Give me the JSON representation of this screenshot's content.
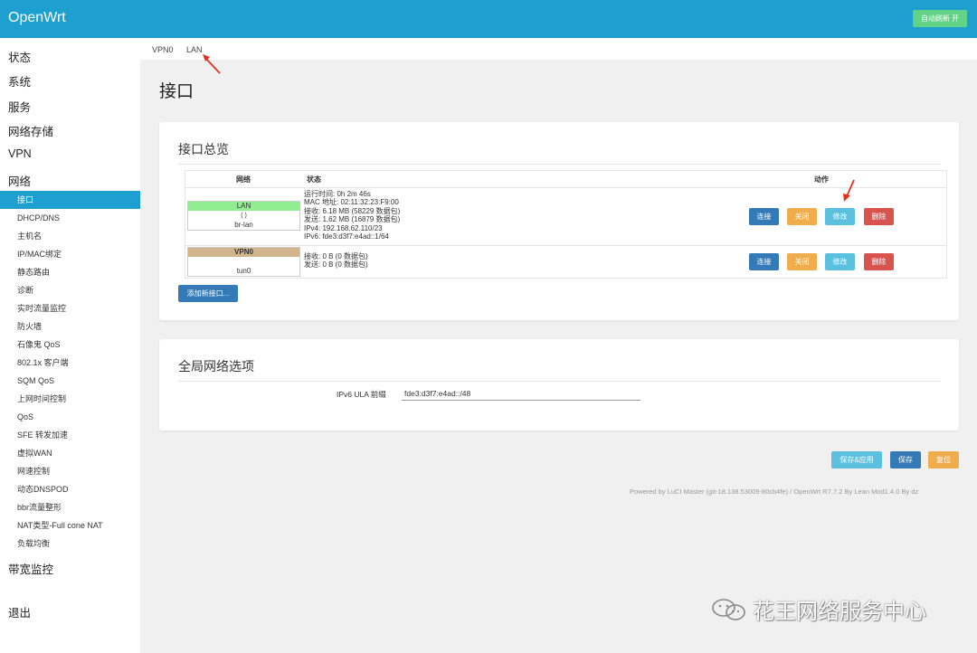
{
  "header": {
    "brand": "OpenWrt",
    "autorefresh": "自动刷新 开"
  },
  "sidebar": {
    "top": [
      "状态",
      "系统",
      "服务",
      "网络存储",
      "VPN",
      "网络"
    ],
    "network_items": [
      "接口",
      "DHCP/DNS",
      "主机名",
      "IP/MAC绑定",
      "静态路由",
      "诊断",
      "实时流量监控",
      "防火墙",
      "石像鬼 QoS",
      "802.1x 客户端",
      "SQM QoS",
      "上网时间控制",
      "QoS",
      "SFE 转发加速",
      "虚拟WAN",
      "网速控制",
      "动态DNSPOD",
      "bbr流量整形",
      "NAT类型-Full cone NAT",
      "负载均衡"
    ],
    "bandwidth": "带宽监控",
    "logout": "退出"
  },
  "tabs": [
    "VPN0",
    "LAN"
  ],
  "page": {
    "title": "接口"
  },
  "overview": {
    "title": "接口总览",
    "headers": {
      "network": "网络",
      "status": "状态",
      "actions": "动作"
    },
    "rows": [
      {
        "name": "LAN",
        "color": "#90ee90",
        "icons": "(  )",
        "device": "br-lan",
        "status": [
          "运行时间: 0h 2m 46s",
          "MAC 地址: 02:11:32:23:F9:00",
          "接收: 6.18 MB (58229 数据包)",
          "发送: 1.62 MB (16879 数据包)",
          "IPv4: 192.168.62.110/23",
          "IPv6: fde3:d3f7:e4ad::1/64"
        ]
      },
      {
        "name": "VPN0",
        "color": "#d2b48c",
        "icons": "",
        "device": "tun0",
        "status": [
          "接收: 0 B (0 数据包)",
          "发送: 0 B (0 数据包)"
        ]
      }
    ],
    "buttons": {
      "connect": "连接",
      "close": "关闭",
      "edit": "修改",
      "delete": "删除"
    },
    "add": "添加新接口..."
  },
  "global": {
    "title": "全局网络选项",
    "ula_label": "IPv6 ULA 前缀",
    "ula_value": "fde3:d3f7:e4ad::/48"
  },
  "actions": {
    "save_apply": "保存&应用",
    "save": "保存",
    "reset": "复位"
  },
  "footer": "Powered by LuCI Master (git-18.138.53009-80cb4fe) / OpenWrt R7.7.2 By Lean Mod1.4.0 By dz",
  "watermark": "花王网络服务中心",
  "colors": {
    "accent": "#1d9fd0",
    "autorefresh": "#62d286",
    "blue": "#337ab7",
    "orange": "#f0ad4e",
    "cyan": "#5bc0de",
    "red": "#d9534f"
  }
}
